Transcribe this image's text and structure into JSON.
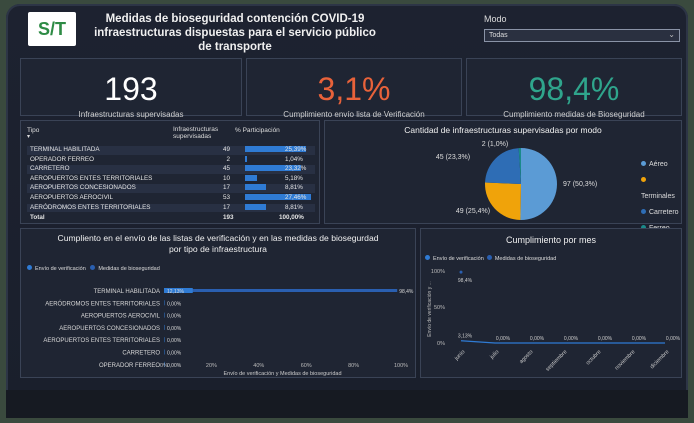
{
  "header": {
    "logo_text": "S/T",
    "title_line1": "Medidas de bioseguridad contención COVID-19",
    "title_line2": "infraestructuras dispuestas para el servicio público de transporte",
    "mode_label": "Modo",
    "mode_value": "Todas"
  },
  "kpis": [
    {
      "value": "193",
      "label": "Infraestructuras supervisadas",
      "color": "#ffffff"
    },
    {
      "value": "3,1%",
      "label": "Cumplimiento envío lista de Verificación",
      "color": "#e8623a"
    },
    {
      "value": "98,4%",
      "label": "Cumplimiento medidas de Bioseguridad",
      "color": "#2fa58c"
    }
  ],
  "table": {
    "col_tipo": "Tipo",
    "col_infra": "Infraestructuras supervisadas",
    "col_part": "% Participación",
    "rows": [
      {
        "tipo": "TERMINAL HABILITADA",
        "count": "49",
        "pct": "25,39%",
        "frac": 0.2539
      },
      {
        "tipo": "OPERADOR FERREO",
        "count": "2",
        "pct": "1,04%",
        "frac": 0.0104
      },
      {
        "tipo": "CARRETERO",
        "count": "45",
        "pct": "23,32%",
        "frac": 0.2332
      },
      {
        "tipo": "AEROPUERTOS ENTES TERRITORIALES",
        "count": "10",
        "pct": "5,18%",
        "frac": 0.0518
      },
      {
        "tipo": "AEROPUERTOS CONCESIONADOS",
        "count": "17",
        "pct": "8,81%",
        "frac": 0.0881
      },
      {
        "tipo": "AEROPUERTOS AEROCIVIL",
        "count": "53",
        "pct": "27,46%",
        "frac": 0.2746
      },
      {
        "tipo": "AERÓDROMOS ENTES TERRITORIALES",
        "count": "17",
        "pct": "8,81%",
        "frac": 0.0881
      }
    ],
    "total_label": "Total",
    "total_count": "193",
    "total_pct": "100,00%"
  },
  "pie": {
    "title": "Cantidad de infraestructuras supervisadas por modo",
    "labels": [
      "97 (50,3%)",
      "49 (25,4%)",
      "45 (23,3%)",
      "2 (1,0%)"
    ],
    "legend": [
      {
        "name": "Aéreo",
        "color": "#5b9bd5"
      },
      {
        "name": "Terminales",
        "color": "#f0a30a"
      },
      {
        "name": "Carretero",
        "color": "#2e6db5"
      },
      {
        "name": "Ferreo",
        "color": "#1a8a8a"
      }
    ]
  },
  "hbar": {
    "title_line1": "Cumpliento en el envío de las listas de verificación y en las medidas de biosegurdad",
    "title_line2": "por tipo de infraestructura",
    "legend1": "Envío de verificación",
    "legend2": "Medidas de bioseguridad",
    "xlabel": "Envío de verificación y Medidas de bioseguridad",
    "ticks": [
      "0%",
      "20%",
      "40%",
      "60%",
      "80%",
      "100%"
    ]
  },
  "line": {
    "title": "Cumplimiento por mes",
    "legend1": "Envío de verificación",
    "legend2": "Medidas de bioseguridad",
    "ylabel": "Envío de verificación y ...",
    "yticks": [
      "100%",
      "50%",
      "0%"
    ],
    "months": [
      "junio",
      "julio",
      "agosto",
      "septiembre",
      "octubre",
      "noviembre",
      "diciembre"
    ],
    "top_label": "98,4%"
  },
  "chart_data": [
    {
      "type": "pie",
      "title": "Cantidad de infraestructuras supervisadas por modo",
      "categories": [
        "Aéreo",
        "Terminales",
        "Carretero",
        "Ferreo"
      ],
      "values": [
        97,
        49,
        45,
        2
      ]
    },
    {
      "type": "bar",
      "title": "Cumpliento en el envío de las listas de verificación y en las medidas de biosegurdad por tipo de infraestructura",
      "categories": [
        "TERMINAL HABILITADA",
        "AERÓDROMOS ENTES TERRITORIALES",
        "AEROPUERTOS AEROCIVIL",
        "AEROPUERTOS CONCESIONADOS",
        "AEROPUERTOS ENTES TERRITORIALES",
        "CARRETERO",
        "OPERADOR FERREO"
      ],
      "series": [
        {
          "name": "Envío de verificación",
          "values": [
            12.13,
            0,
            0,
            0,
            0,
            0,
            0
          ],
          "labels": [
            "12,13%",
            "0,00%",
            "0,00%",
            "0,00%",
            "0,00%",
            "0,00%",
            "0,00%"
          ]
        },
        {
          "name": "Medidas de bioseguridad",
          "values": [
            98.4,
            0,
            0,
            0,
            0,
            0,
            0
          ],
          "labels": [
            "98,4%",
            "",
            "",
            "",
            "",
            "",
            ""
          ]
        }
      ],
      "xlabel": "Envío de verificación y Medidas de bioseguridad",
      "xlim": [
        0,
        100
      ]
    },
    {
      "type": "line",
      "title": "Cumplimiento por mes",
      "x": [
        "junio",
        "julio",
        "agosto",
        "septiembre",
        "octubre",
        "noviembre",
        "diciembre"
      ],
      "series": [
        {
          "name": "Envío de verificación",
          "values": [
            3.13,
            0,
            0,
            0,
            0,
            0,
            0
          ],
          "labels": [
            "3,13%",
            "0,00%",
            "0,00%",
            "0,00%",
            "0,00%",
            "0,00%",
            "0,00%"
          ]
        },
        {
          "name": "Medidas de bioseguridad",
          "values": [
            98.4,
            null,
            null,
            null,
            null,
            null,
            null
          ],
          "labels": [
            "98,4%",
            "",
            "",
            "",
            "",
            "",
            ""
          ]
        }
      ],
      "ylabel": "Envío de verificación y ...",
      "ylim": [
        0,
        100
      ]
    }
  ]
}
